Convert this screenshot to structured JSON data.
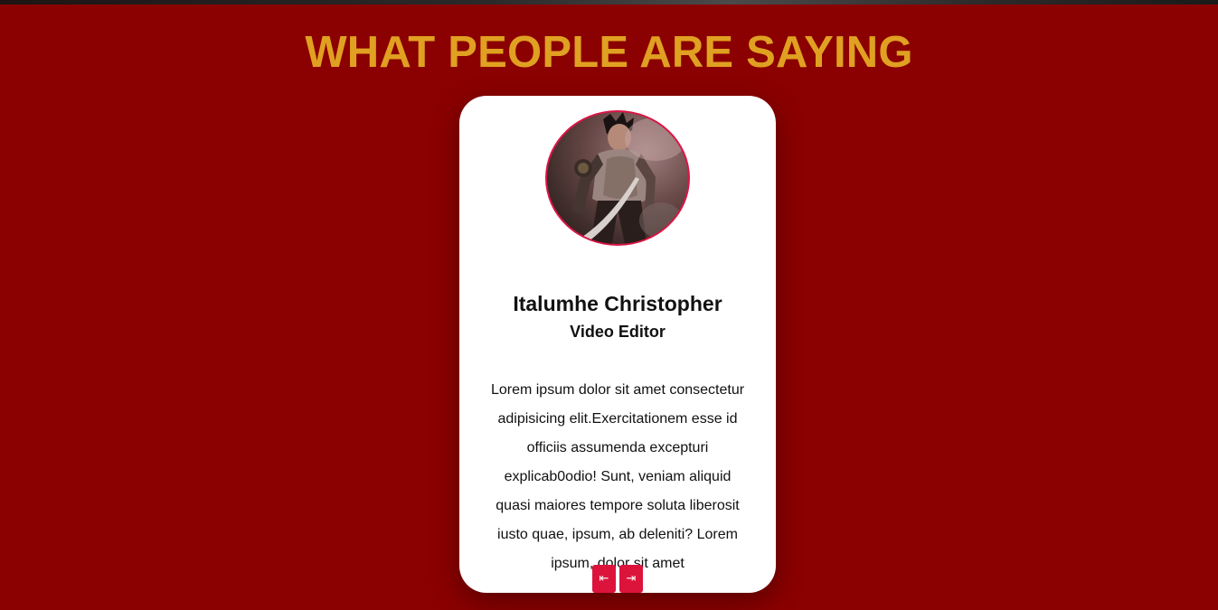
{
  "section": {
    "title": "WHAT PEOPLE ARE SAYING"
  },
  "testimonial": {
    "name": "Italumhe Christopher",
    "role": "Video Editor",
    "quote": "Lorem ipsum dolor sit amet consectetur adipisicing elit.Exercitationem esse id officiis assumenda excepturi explicab0odio! Sunt, veniam aliquid quasi maiores tempore soluta liberosit iusto quae, ipsum, ab deleniti? Lorem ipsum, dolor sit amet",
    "avatar_icon": "anime-character-avatar"
  },
  "navigation": {
    "prev_glyph": "⇤",
    "next_glyph": "⇥"
  },
  "colors": {
    "background": "#8b0000",
    "title": "#e0a021",
    "card": "#ffffff",
    "accent": "#dc143c"
  }
}
